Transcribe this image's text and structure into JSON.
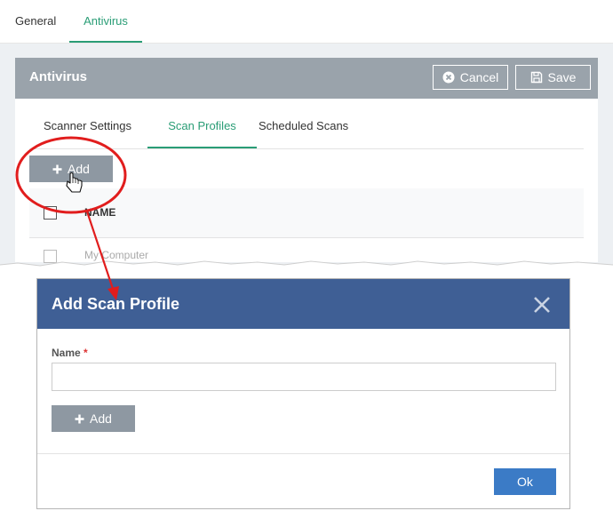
{
  "top_tabs": [
    {
      "label": "General"
    },
    {
      "label": "Antivirus"
    }
  ],
  "panel": {
    "title": "Antivirus",
    "cancel_label": "Cancel",
    "save_label": "Save"
  },
  "sub_tabs": [
    {
      "label": "Scanner Settings"
    },
    {
      "label": "Scan Profiles"
    },
    {
      "label": "Scheduled Scans"
    }
  ],
  "toolbar": {
    "add_label": "Add"
  },
  "table": {
    "header_name": "NAME",
    "rows": [
      {
        "name": "My Computer"
      }
    ]
  },
  "dialog": {
    "title": "Add Scan Profile",
    "name_label": "Name",
    "required_mark": "*",
    "name_value": "",
    "add_label": "Add",
    "ok_label": "Ok"
  },
  "colors": {
    "accent_green": "#2a9d76",
    "header_gray": "#9aa3ab",
    "dialog_blue": "#3f5f95",
    "ok_blue": "#3b7bc6",
    "annotation_red": "#e11d1d"
  }
}
